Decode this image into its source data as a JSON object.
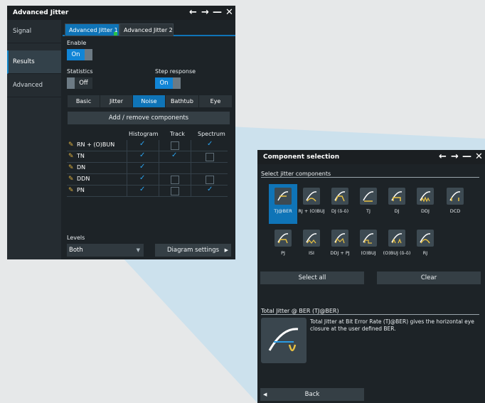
{
  "left_window": {
    "title": "Advanced Jitter",
    "sidebar": [
      {
        "label": "Signal"
      },
      {
        "label": "Results"
      },
      {
        "label": "Advanced"
      }
    ],
    "tabs": [
      {
        "label": "Advanced Jitter 1"
      },
      {
        "label": "Advanced Jitter 2"
      }
    ],
    "enable_label": "Enable",
    "enable_state": "On",
    "statistics_label": "Statistics",
    "statistics_state": "Off",
    "step_response_label": "Step response",
    "step_response_state": "On",
    "segments": [
      "Basic",
      "Jitter",
      "Noise",
      "Bathtub",
      "Eye"
    ],
    "add_remove_label": "Add / remove components",
    "grid_headers": [
      "Histogram",
      "Track",
      "Spectrum"
    ],
    "rows": [
      {
        "name": "RN + (O)BUN",
        "histogram": true,
        "track": false,
        "spectrum": true
      },
      {
        "name": "TN",
        "histogram": true,
        "track": true,
        "spectrum": false
      },
      {
        "name": "DN",
        "histogram": true,
        "track": false,
        "spectrum": false
      },
      {
        "name": "DDN",
        "histogram": true,
        "track": false,
        "spectrum": false
      },
      {
        "name": "PN",
        "histogram": true,
        "track": false,
        "spectrum": true
      }
    ],
    "levels_label": "Levels",
    "levels_value": "Both",
    "diagram_settings_label": "Diagram settings"
  },
  "right_window": {
    "title": "Component selection",
    "select_label": "Select jitter components",
    "components_row1": [
      "TJ@BER",
      "RJ + (O)BUJ",
      "DJ (δ-δ)",
      "TJ",
      "DJ",
      "DDJ",
      "DCD"
    ],
    "components_row2": [
      "PJ",
      "ISI",
      "DDJ + PJ",
      "(O)BUJ",
      "(O)BUJ (δ-δ)",
      "RJ"
    ],
    "select_all_label": "Select all",
    "clear_label": "Clear",
    "detail_title": "Total Jitter @ BER (TJ@BER)",
    "detail_text": "Total Jitter at Bit Error Rate (TJ@BER) gives the horizontal eye closure at the user defined BER.",
    "back_label": "Back"
  },
  "colors": {
    "accent": "#0f74b7",
    "window_bg": "#1d2327",
    "zoom_overlay": "#a9d3ec"
  }
}
